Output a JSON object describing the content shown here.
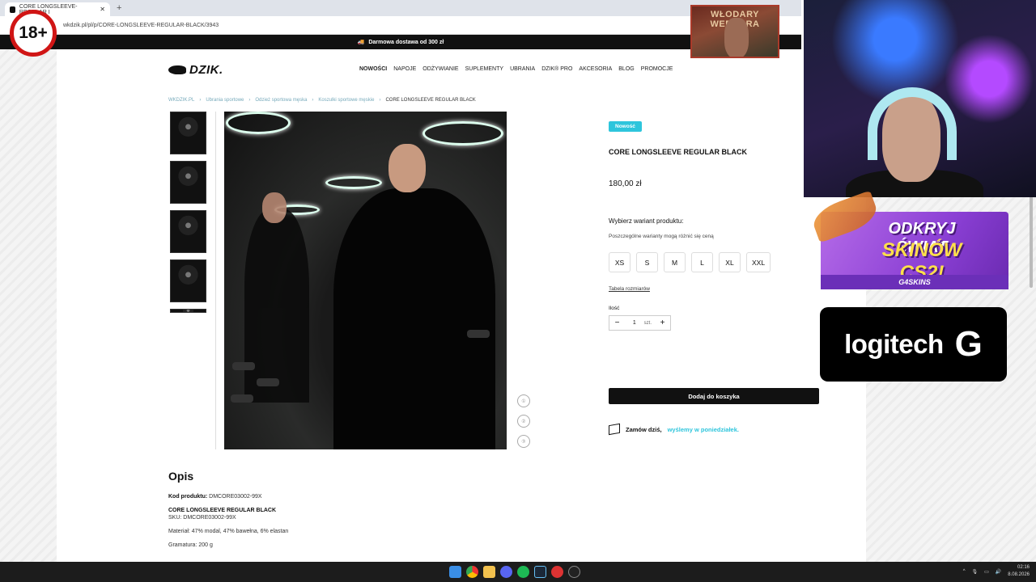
{
  "browser": {
    "tab_title": "CORE LONGSLEEVE-REGULAR I",
    "new_tab": "+",
    "close": "✕",
    "url": "wkdzik.pl/pl/p/CORE-LONGSLEEVE-REGULAR-BLACK/3943"
  },
  "promo_bar": "Darmowa dostawa od 300 zł",
  "site": {
    "logo": "DZIK.",
    "nav": [
      "NOWOŚCI",
      "NAPOJE",
      "ODŻYWIANIE",
      "SUPLEMENTY",
      "UBRANIA",
      "DZIK® PRO",
      "AKCESORIA",
      "BLOG",
      "PROMOCJE"
    ],
    "breadcrumb": [
      "WKDZIK.PL",
      "Ubrania sportowe",
      "Odzież sportowa męska",
      "Koszulki sportowe męskie",
      "CORE LONGSLEEVE REGULAR BLACK"
    ],
    "gallery_pager": [
      "①",
      "②",
      "③"
    ]
  },
  "product": {
    "badge": "Nowość",
    "title": "CORE LONGSLEEVE REGULAR BLACK",
    "price": "180,00 zł",
    "variant_label": "Wybierz wariant produktu:",
    "variant_note": "Poszczególne warianty mogą różnić się ceną",
    "sizes": [
      "XS",
      "S",
      "M",
      "L",
      "XL",
      "XXL"
    ],
    "size_chart": "Tabela rozmiarów",
    "qty_label": "Ilość",
    "qty_value": "1",
    "qty_unit": "szt.",
    "qty_minus": "−",
    "qty_plus": "+",
    "add_to_cart": "Dodaj do koszyka",
    "ship_prefix": "Zamów dziś,",
    "ship_link": "wyślemy w poniedziałek."
  },
  "description": {
    "heading": "Opis",
    "code_label": "Kod produktu:",
    "code_value": "DMCORE03002-99X",
    "name": "CORE LONGSLEEVE REGULAR BLACK",
    "sku": "SKU: DMCORE03002-99X",
    "material": "Materiał: 47% modal, 47% bawełna, 6% elastan",
    "weight": "Gramatura: 200 g"
  },
  "overlays": {
    "age_badge": "18+",
    "banner_top": "WŁODARY WEDBARA",
    "g4_line1": "ODKRYJ ŚWIAT",
    "g4_line2": "SKINÓW CS2!",
    "g4_brand": "G4SKINS",
    "logitech": "logitech",
    "logitech_mark": "G"
  },
  "taskbar": {
    "time": "02:16",
    "date": "8.08.2026"
  }
}
